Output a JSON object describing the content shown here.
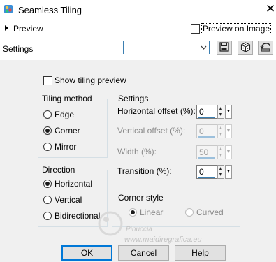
{
  "window": {
    "title": "Seamless Tiling",
    "app_icon": "psp-app-icon",
    "close_icon": "close-icon"
  },
  "header": {
    "preview_label": "Preview",
    "preview_on_image_label": "Preview on Image",
    "preview_on_image_checked": false,
    "settings_label": "Settings",
    "preset_value": "",
    "save_icon": "save-icon",
    "randomize_icon": "dice-icon",
    "reset_icon": "reset-icon"
  },
  "show_tiling_preview": {
    "label": "Show tiling preview",
    "checked": false
  },
  "tiling_method": {
    "title": "Tiling method",
    "options": [
      {
        "label": "Edge",
        "selected": false
      },
      {
        "label": "Corner",
        "selected": true
      },
      {
        "label": "Mirror",
        "selected": false
      }
    ]
  },
  "direction": {
    "title": "Direction",
    "options": [
      {
        "label": "Horizontal",
        "selected": true
      },
      {
        "label": "Vertical",
        "selected": false
      },
      {
        "label": "Bidirectional",
        "selected": false
      }
    ]
  },
  "settings_group": {
    "title": "Settings",
    "horizontal_offset": {
      "label": "Horizontal offset (%):",
      "value": "0",
      "enabled": true
    },
    "vertical_offset": {
      "label": "Vertical offset (%):",
      "value": "0",
      "enabled": false
    },
    "width": {
      "label": "Width (%):",
      "value": "50",
      "enabled": false
    },
    "transition": {
      "label": "Transition (%):",
      "value": "0",
      "enabled": true
    }
  },
  "corner_style": {
    "title": "Corner style",
    "options": [
      {
        "label": "Linear",
        "selected": true,
        "enabled": false
      },
      {
        "label": "Curved",
        "selected": false,
        "enabled": false
      }
    ]
  },
  "watermark": {
    "line1": "Pinuccia",
    "line2": "www.maidiregrafica.eu"
  },
  "buttons": {
    "ok": "OK",
    "cancel": "Cancel",
    "help": "Help"
  }
}
